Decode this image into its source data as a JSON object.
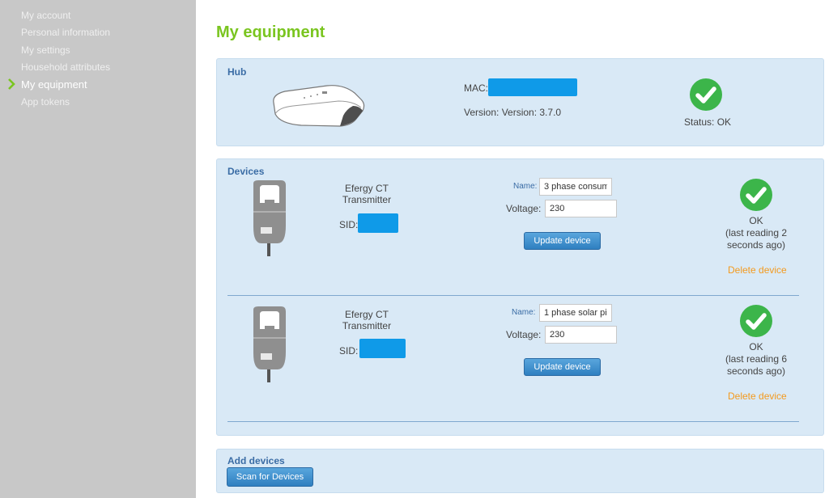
{
  "sidebar": {
    "items": [
      {
        "label": "My account"
      },
      {
        "label": "Personal information"
      },
      {
        "label": "My settings"
      },
      {
        "label": "Household attributes"
      },
      {
        "label": "My equipment"
      },
      {
        "label": "App tokens"
      }
    ],
    "active_index": 4,
    "arrow_color": "#7ac520"
  },
  "page": {
    "title": "My equipment"
  },
  "hub": {
    "title": "Hub",
    "mac_label": "MAC:",
    "version_text": "Version: Version: 3.7.0",
    "status_text": "Status: OK"
  },
  "devices": {
    "title": "Devices",
    "items": [
      {
        "name_line1": "Efergy CT",
        "name_line2": "Transmitter",
        "sid_label": "SID:",
        "name_field_label": "Name:",
        "name_value": "3 phase consum",
        "voltage_label": "Voltage:",
        "voltage_value": "230",
        "update_label": "Update device",
        "status_ok": "OK",
        "status_line2": "(last reading 2",
        "status_line3": "seconds ago)",
        "delete_label": "Delete device"
      },
      {
        "name_line1": "Efergy CT",
        "name_line2": "Transmitter",
        "sid_label": "SID:",
        "name_field_label": "Name:",
        "name_value": "1 phase solar pi",
        "voltage_label": "Voltage:",
        "voltage_value": "230",
        "update_label": "Update device",
        "status_ok": "OK",
        "status_line2": "(last reading 6",
        "status_line3": "seconds ago)",
        "delete_label": "Delete device"
      }
    ]
  },
  "add_devices": {
    "title": "Add devices",
    "scan_label": "Scan for Devices"
  },
  "colors": {
    "accent_green": "#7ac520",
    "panel_bg": "#d9e9f6",
    "link_orange": "#f39a1e",
    "button_blue": "#2f7fc0",
    "redaction_blue": "#0f9ae8"
  }
}
